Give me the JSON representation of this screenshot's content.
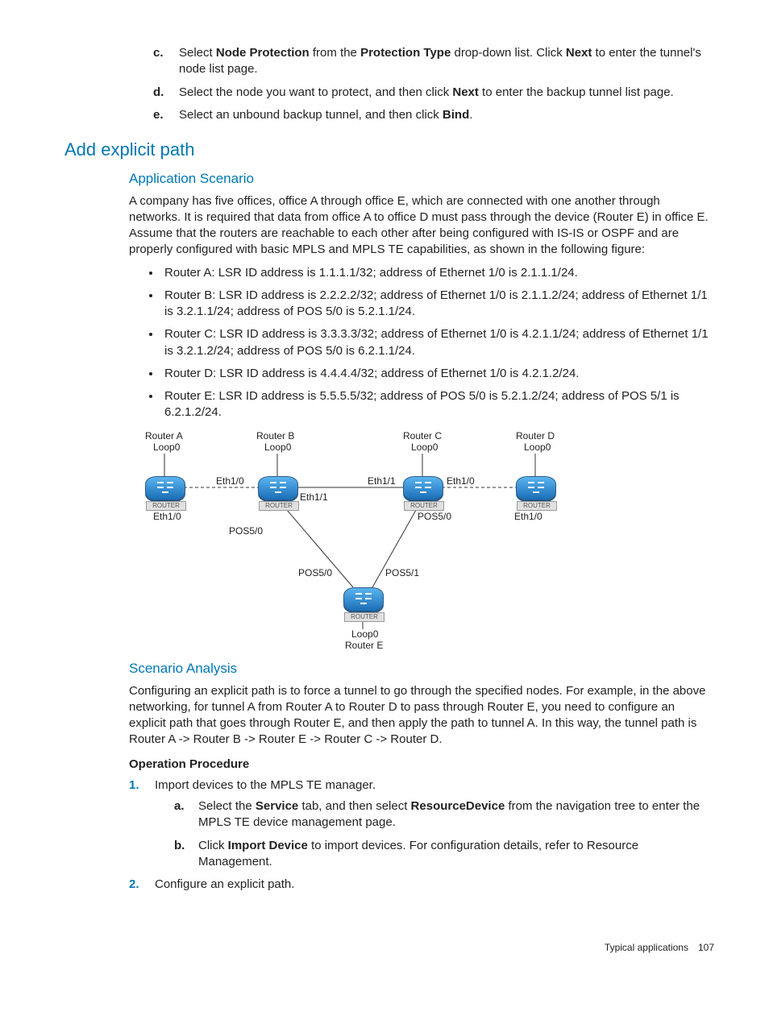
{
  "top_steps": [
    {
      "m": "c.",
      "html": "Select <span class='b'>Node Protection</span> from the <span class='b'>Protection Type</span> drop-down list. Click <span class='b'>Next</span> to enter the tunnel's node list page."
    },
    {
      "m": "d.",
      "html": "Select the node you want to protect, and then click <span class='b'>Next</span> to enter the backup tunnel list page."
    },
    {
      "m": "e.",
      "html": "Select an unbound backup tunnel, and then click <span class='b'>Bind</span>."
    }
  ],
  "h2": "Add explicit path",
  "app_scenario_title": "Application Scenario",
  "app_scenario_para": "A company has five offices, office A through office E, which are connected with one another through networks. It is required that data from office A to office D must pass through the device (Router E) in office E. Assume that the routers are reachable to each other after being configured with IS-IS or OSPF and are properly configured with basic MPLS and MPLS TE capabilities, as shown in the following figure:",
  "routers": [
    "Router A: LSR ID address is 1.1.1.1/32; address of Ethernet 1/0 is 2.1.1.1/24.",
    "Router B: LSR ID address is 2.2.2.2/32; address of Ethernet 1/0 is 2.1.1.2/24; address of Ethernet 1/1 is 3.2.1.1/24; address of POS 5/0 is 5.2.1.1/24.",
    "Router C: LSR ID address is 3.3.3.3/32; address of Ethernet 1/0 is 4.2.1.1/24; address of Ethernet 1/1 is 3.2.1.2/24; address of POS 5/0 is 6.2.1.1/24.",
    "Router D: LSR ID address is 4.4.4.4/32; address of Ethernet 1/0 is 4.2.1.2/24.",
    "Router E: LSR ID address is 5.5.5.5/32; address of POS 5/0 is 5.2.1.2/24; address of POS 5/1 is 6.2.1.2/24."
  ],
  "diagram": {
    "routerA": "Router A",
    "routerB": "Router B",
    "routerC": "Router C",
    "routerD": "Router D",
    "routerE": "Router E",
    "loop0": "Loop0",
    "eth10": "Eth1/0",
    "eth11": "Eth1/1",
    "pos50": "POS5/0",
    "pos51": "POS5/1",
    "routerTag": "ROUTER"
  },
  "analysis_title": "Scenario Analysis",
  "analysis_para": "Configuring an explicit path is to force a tunnel to go through the specified nodes. For example, in the above networking, for tunnel A from Router A to Router D to pass through Router E, you need to configure an explicit path that goes through Router E, and then apply the path to tunnel A. In this way, the tunnel path is Router A -> Router B -> Router E -> Router C -> Router D.",
  "op_title": "Operation Procedure",
  "op_steps": [
    {
      "num": "1.",
      "text": "Import devices to the MPLS TE manager.",
      "sub": [
        {
          "m": "a.",
          "html": "Select the <span class='b'>Service</span> tab, and then select <span class='b'>ResourceDevice</span> from the navigation tree to enter the MPLS TE device management page."
        },
        {
          "m": "b.",
          "html": "Click <span class='b'>Import Device</span> to import devices. For configuration details, refer to Resource Management."
        }
      ]
    },
    {
      "num": "2.",
      "text": "Configure an explicit path.",
      "sub": []
    }
  ],
  "footer": "Typical applications 107"
}
